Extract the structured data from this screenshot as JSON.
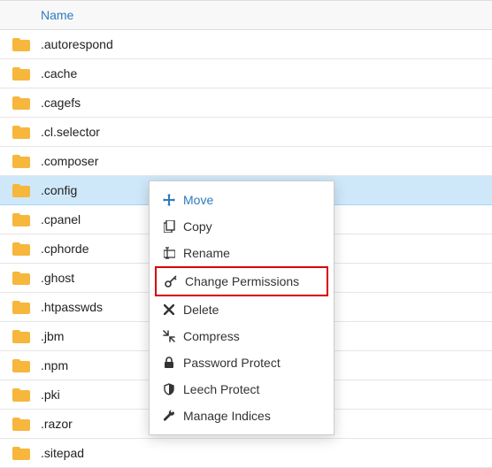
{
  "header": {
    "name": "Name"
  },
  "files": [
    {
      "name": ".autorespond"
    },
    {
      "name": ".cache"
    },
    {
      "name": ".cagefs"
    },
    {
      "name": ".cl.selector"
    },
    {
      "name": ".composer"
    },
    {
      "name": ".config",
      "selected": true
    },
    {
      "name": ".cpanel"
    },
    {
      "name": ".cphorde"
    },
    {
      "name": ".ghost"
    },
    {
      "name": ".htpasswds"
    },
    {
      "name": ".jbm"
    },
    {
      "name": ".npm"
    },
    {
      "name": ".pki"
    },
    {
      "name": ".razor"
    },
    {
      "name": ".sitepad"
    }
  ],
  "menu": {
    "move": "Move",
    "copy": "Copy",
    "rename": "Rename",
    "change_permissions": "Change Permissions",
    "delete": "Delete",
    "compress": "Compress",
    "password_protect": "Password Protect",
    "leech_protect": "Leech Protect",
    "manage_indices": "Manage Indices"
  }
}
